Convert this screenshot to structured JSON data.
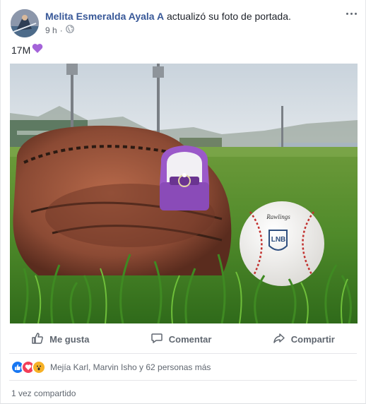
{
  "post": {
    "author_name": "Melita Esmeralda Ayala A",
    "action_text": " actualizó su foto de portada.",
    "time": "9 h",
    "separator": "·",
    "text": "17M",
    "privacy_icon": "public-globe-icon",
    "emoji": "purple-heart-icon"
  },
  "photo": {
    "ball_logo": "LNB",
    "ball_brand": "Rawlings"
  },
  "actions": {
    "like_label": "Me gusta",
    "comment_label": "Comentar",
    "share_label": "Compartir"
  },
  "reactions": {
    "icons": [
      "like-reaction-icon",
      "love-reaction-icon",
      "wow-reaction-icon"
    ],
    "summary": "Mejía Karl, Marvin Isho y 62 personas más"
  },
  "shares": {
    "label": "1 vez compartido"
  },
  "colors": {
    "name_link": "#385898",
    "secondary_text": "#606770",
    "like_blue": "#1877f2",
    "love_red": "#f33e58",
    "wow_yellow": "#f7b125",
    "heart_purple": "#a463d9"
  }
}
